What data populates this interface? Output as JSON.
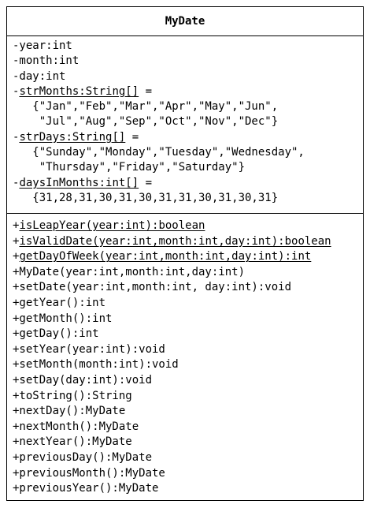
{
  "class_name": "MyDate",
  "attributes": [
    {
      "text": "-year:int",
      "static": false
    },
    {
      "text": "-month:int",
      "static": false
    },
    {
      "text": "-day:int",
      "static": false
    },
    {
      "text": "-strMonths:String[] =",
      "static": true
    },
    {
      "text": "   {\"Jan\",\"Feb\",\"Mar\",\"Apr\",\"May\",\"Jun\",",
      "static": false
    },
    {
      "text": "    \"Jul\",\"Aug\",\"Sep\",\"Oct\",\"Nov\",\"Dec\"}",
      "static": false
    },
    {
      "text": "-strDays:String[] =",
      "static": true
    },
    {
      "text": "   {\"Sunday\",\"Monday\",\"Tuesday\",\"Wednesday\",",
      "static": false
    },
    {
      "text": "    \"Thursday\",\"Friday\",\"Saturday\"}",
      "static": false
    },
    {
      "text": "-daysInMonths:int[] =",
      "static": true
    },
    {
      "text": "   {31,28,31,30,31,30,31,31,30,31,30,31}",
      "static": false
    }
  ],
  "methods": [
    {
      "text": "+isLeapYear(year:int):boolean",
      "static": true
    },
    {
      "text": "+isValidDate(year:int,month:int,day:int):boolean",
      "static": true
    },
    {
      "text": "+getDayOfWeek(year:int,month:int,day:int):int",
      "static": true
    },
    {
      "text": "+MyDate(year:int,month:int,day:int)",
      "static": false
    },
    {
      "text": "+setDate(year:int,month:int, day:int):void",
      "static": false
    },
    {
      "text": "+getYear():int",
      "static": false
    },
    {
      "text": "+getMonth():int",
      "static": false
    },
    {
      "text": "+getDay():int",
      "static": false
    },
    {
      "text": "+setYear(year:int):void",
      "static": false
    },
    {
      "text": "+setMonth(month:int):void",
      "static": false
    },
    {
      "text": "+setDay(day:int):void",
      "static": false
    },
    {
      "text": "+toString():String",
      "static": false
    },
    {
      "text": "+nextDay():MyDate",
      "static": false
    },
    {
      "text": "+nextMonth():MyDate",
      "static": false
    },
    {
      "text": "+nextYear():MyDate",
      "static": false
    },
    {
      "text": "+previousDay():MyDate",
      "static": false
    },
    {
      "text": "+previousMonth():MyDate",
      "static": false
    },
    {
      "text": "+previousYear():MyDate",
      "static": false
    }
  ]
}
